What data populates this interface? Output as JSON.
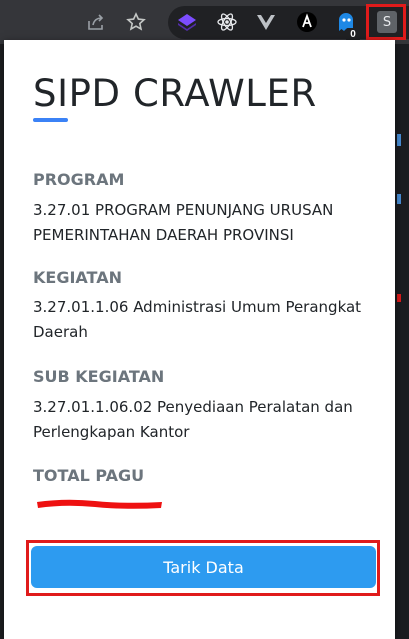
{
  "toolbar": {
    "icons": [
      "share-icon",
      "star-icon",
      "extension-icons"
    ],
    "badge_count": "0",
    "active_extension_letter": "S"
  },
  "popup": {
    "title": "SIPD CRAWLER",
    "program_label": "PROGRAM",
    "program_value": "3.27.01 PROGRAM PENUNJANG URUSAN PEMERINTAHAN DAERAH PROVINSI",
    "kegiatan_label": "KEGIATAN",
    "kegiatan_value": "3.27.01.1.06 Administrasi Umum Perangkat Daerah",
    "sub_kegiatan_label": "SUB KEGIATAN",
    "sub_kegiatan_value": "3.27.01.1.06.02 Penyediaan Peralatan dan Perlengkapan Kantor",
    "total_pagu_label": "TOTAL PAGU",
    "total_pagu_value": "[redacted]",
    "button_label": "Tarik Data"
  },
  "colors": {
    "accent": "#2d9bf0",
    "title_underline": "#3b82f6",
    "highlight_red": "#e01b1b",
    "label_gray": "#6c757d"
  }
}
